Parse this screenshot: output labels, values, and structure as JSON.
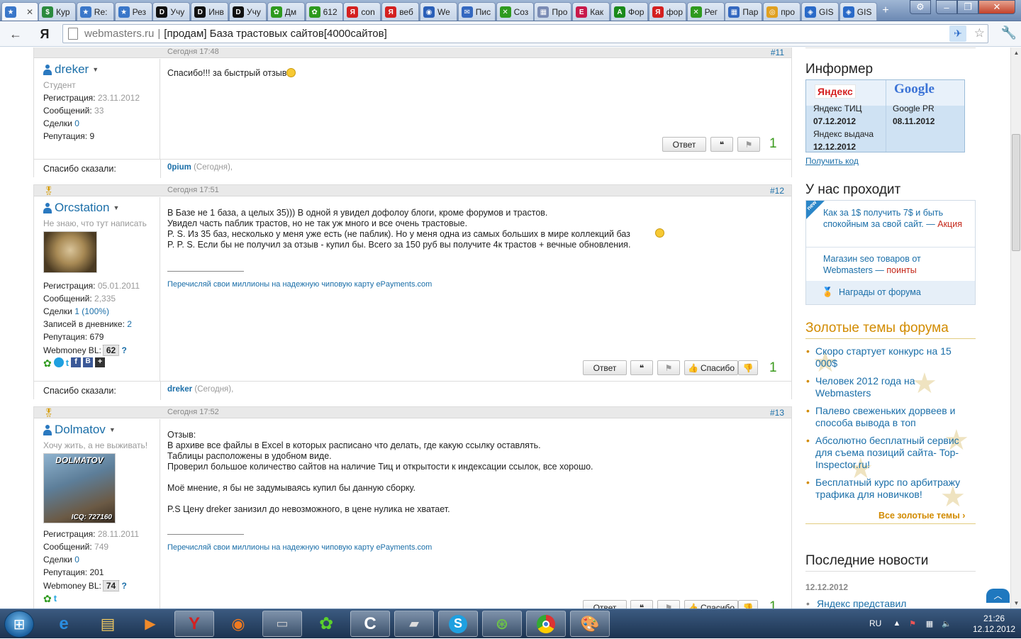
{
  "browser": {
    "tabs": [
      {
        "label": "",
        "color": "#3a77c9",
        "glyph": "★"
      },
      {
        "label": "Кур",
        "color": "#2b8a3e",
        "glyph": "$"
      },
      {
        "label": "Re:",
        "color": "#3a77c9",
        "glyph": "★"
      },
      {
        "label": "Рез",
        "color": "#3a77c9",
        "glyph": "★"
      },
      {
        "label": "Учу",
        "color": "#111",
        "glyph": "D"
      },
      {
        "label": "Инв",
        "color": "#111",
        "glyph": "D"
      },
      {
        "label": "Учу",
        "color": "#111",
        "glyph": "D"
      },
      {
        "label": "Дм",
        "color": "#2e9a1e",
        "glyph": "✿"
      },
      {
        "label": "612",
        "color": "#2e9a1e",
        "glyph": "✿"
      },
      {
        "label": "con",
        "color": "#d42020",
        "glyph": "Я"
      },
      {
        "label": "веб",
        "color": "#d42020",
        "glyph": "Я"
      },
      {
        "label": "We",
        "color": "#2a5fb8",
        "glyph": "◉"
      },
      {
        "label": "Пис",
        "color": "#3468c0",
        "glyph": "✉"
      },
      {
        "label": "Соз",
        "color": "#2e9a1e",
        "glyph": "✕"
      },
      {
        "label": "Про",
        "color": "#7a8bb4",
        "glyph": "▦"
      },
      {
        "label": "Как",
        "color": "#c8194b",
        "glyph": "E"
      },
      {
        "label": "Фор",
        "color": "#1a8a1a",
        "glyph": "A"
      },
      {
        "label": "фор",
        "color": "#d42020",
        "glyph": "Я"
      },
      {
        "label": "Рег",
        "color": "#2e9a1e",
        "glyph": "✕"
      },
      {
        "label": "Пар",
        "color": "#3468c0",
        "glyph": "▦"
      },
      {
        "label": "про",
        "color": "#e0a020",
        "glyph": "◎"
      },
      {
        "label": "GIS",
        "color": "#2a6ac8",
        "glyph": "◈"
      },
      {
        "label": "GIS",
        "color": "#2a6ac8",
        "glyph": "◈"
      }
    ],
    "new_tab": "+",
    "url_host": "webmasters.ru",
    "url_path": "[продам] База трастовых сайтов[4000сайтов]"
  },
  "posts": [
    {
      "date": "Сегодня 17:48",
      "number": "#11",
      "user": {
        "name": "dreker",
        "title": "Студент"
      },
      "stats": [
        {
          "label": "Регистрация:",
          "value": "23.11.2012",
          "kind": "grey"
        },
        {
          "label": "Сообщений:",
          "value": "33",
          "kind": "grey"
        },
        {
          "label": "Сделки",
          "value": "0",
          "kind": "link"
        },
        {
          "label": "Репутация:",
          "value": "9",
          "kind": "plain"
        }
      ],
      "message": "Спасибо!!! за быстрый отзыв",
      "buttons": {
        "reply": "Ответ"
      },
      "likes": "1",
      "thanks_label": "Спасибо сказали:",
      "thanks_user": "0pium",
      "thanks_when": "(Сегодня),"
    },
    {
      "date": "Сегодня 17:51",
      "number": "#12",
      "user": {
        "name": "Orcstation",
        "title": "Не знаю, что тут написать"
      },
      "stats": [
        {
          "label": "Регистрация:",
          "value": "05.01.2011",
          "kind": "grey"
        },
        {
          "label": "Сообщений:",
          "value": "2,335",
          "kind": "grey"
        },
        {
          "label": "Сделки",
          "value": "1 (100%)",
          "kind": "link"
        },
        {
          "label": "Записей в дневнике:",
          "value": "2",
          "kind": "link"
        },
        {
          "label": "Репутация:",
          "value": "679",
          "kind": "plain"
        }
      ],
      "webmoney_label": "Webmoney BL:",
      "webmoney_value": "62",
      "message": "В Базе не 1 база, а целых 35))) В одной я увидел дофолоу блоги, кроме форумов и трастов.\nУвидел часть паблик трастов, но не так уж много и все очень трастовые.\nP. S. Из 35 баз, несколько у меня уже есть (не паблик). Но у меня одна из самых больших в мире коллекций баз\nP. P. S. Если бы не получил за отзыв - купил бы. Всего за 150 руб вы получите 4к трастов + вечные обновления.",
      "signature": "Перечисляй свои миллионы на надежную чиповую карту ePayments.com",
      "buttons": {
        "reply": "Ответ",
        "thanks": "Спасибо"
      },
      "likes": "1",
      "thanks_label": "Спасибо сказали:",
      "thanks_user": "dreker",
      "thanks_when": "(Сегодня),"
    },
    {
      "date": "Сегодня 17:52",
      "number": "#13",
      "user": {
        "name": "Dolmatov",
        "title": "Хочу жить, а не выживать!"
      },
      "avatar_text": "DOLMATOV",
      "avatar_icq": "ICQ: 727160",
      "stats": [
        {
          "label": "Регистрация:",
          "value": "28.11.2011",
          "kind": "grey"
        },
        {
          "label": "Сообщений:",
          "value": "749",
          "kind": "grey"
        },
        {
          "label": "Сделки",
          "value": "0",
          "kind": "link"
        },
        {
          "label": "Репутация:",
          "value": "201",
          "kind": "plain"
        }
      ],
      "webmoney_label": "Webmoney BL:",
      "webmoney_value": "74",
      "message": "Отзыв:\nВ архиве все файлы в Excel в которых расписано что делать, где какую ссылку оставлять.\nТаблицы расположены в удобном виде.\nПроверил большое количество сайтов на наличие Тиц и открытости к индексации ссылок, все хорошо.\n\nМоё мнение, я бы не задумываясь купил бы данную сборку.\n\nP.S Цену dreker занизил до невозможного, в цене нулика не хватает.",
      "signature": "Перечисляй свои миллионы на надежную чиповую карту ePayments.com",
      "buttons": {
        "reply": "Ответ",
        "thanks": "Спасибо"
      },
      "likes": "1"
    }
  ],
  "sidebar": {
    "informer": {
      "title": "Информер",
      "yandex_logo": "Яндекс",
      "google_logo": "Google",
      "tic_label": "Яндекс ТИЦ",
      "tic_date": "07.12.2012",
      "pr_label": "Google PR",
      "pr_date": "08.11.2012",
      "index_label": "Яндекс выдача",
      "index_date": "12.12.2012",
      "get_code": "Получить код"
    },
    "passing": {
      "title": "У нас проходит",
      "badge": "new",
      "item1": "Как за 1$ получить 7$ и быть спокойным за свой сайт. —",
      "item1_tag": "Акция",
      "item2": "Магазин seo товаров от Webmasters —",
      "item2_tag": "поинты",
      "item3": "Награды от форума"
    },
    "gold": {
      "title": "Золотые темы форума",
      "items": [
        "Скоро стартует конкурс на 15 000$",
        "Человек 2012 года на Webmasters",
        "Палево свеженьких дорвеев и способа вывода в топ",
        "Абсолютно бесплатный сервис для съема позиций сайта- Top-Inspector.ru!",
        "Бесплатный курс по арбитражу трафика для новичков!"
      ],
      "all": "Все золотые темы ›"
    },
    "news": {
      "title": "Последние новости",
      "date": "12.12.2012",
      "item": "Яндекс представил"
    }
  },
  "taskbar": {
    "lang": "RU",
    "time": "21:26",
    "date": "12.12.2012"
  }
}
